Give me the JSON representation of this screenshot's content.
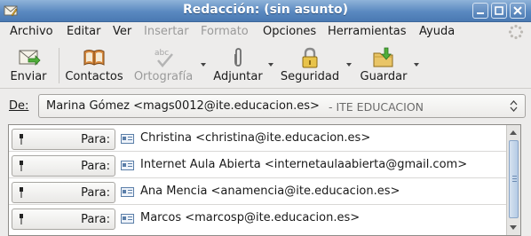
{
  "window": {
    "title": "Redacción: (sin asunto)"
  },
  "menubar": {
    "items": [
      {
        "label": "Archivo",
        "disabled": false
      },
      {
        "label": "Editar",
        "disabled": false
      },
      {
        "label": "Ver",
        "disabled": false
      },
      {
        "label": "Insertar",
        "disabled": true
      },
      {
        "label": "Formato",
        "disabled": true
      },
      {
        "label": "Opciones",
        "disabled": false
      },
      {
        "label": "Herramientas",
        "disabled": false
      },
      {
        "label": "Ayuda",
        "disabled": false
      }
    ]
  },
  "toolbar": {
    "send": {
      "label": "Enviar",
      "icon": "send-mail-icon"
    },
    "contacts": {
      "label": "Contactos",
      "icon": "address-book-icon"
    },
    "spelling": {
      "label": "Ortografía",
      "icon": "spellcheck-icon",
      "disabled": true
    },
    "attach": {
      "label": "Adjuntar",
      "icon": "paperclip-icon"
    },
    "security": {
      "label": "Seguridad",
      "icon": "padlock-icon"
    },
    "save": {
      "label": "Guardar",
      "icon": "save-folder-icon"
    }
  },
  "from": {
    "label": "De:",
    "value": "Marina Gómez <mags0012@ite.educacion.es>",
    "account": "- ITE EDUCACION"
  },
  "recipients": [
    {
      "type": "Para:",
      "address": "Christina <christina@ite.educacion.es>"
    },
    {
      "type": "Para:",
      "address": "Internet Aula Abierta <internetaulaabierta@gmail.com>"
    },
    {
      "type": "Para:",
      "address": "Ana Mencia <anamencia@ite.educacion.es>"
    },
    {
      "type": "Para:",
      "address": "Marcos <marcosp@ite.educacion.es>"
    }
  ],
  "colors": {
    "titlebar": "#5a89c0",
    "window_bg": "#edeceb"
  }
}
